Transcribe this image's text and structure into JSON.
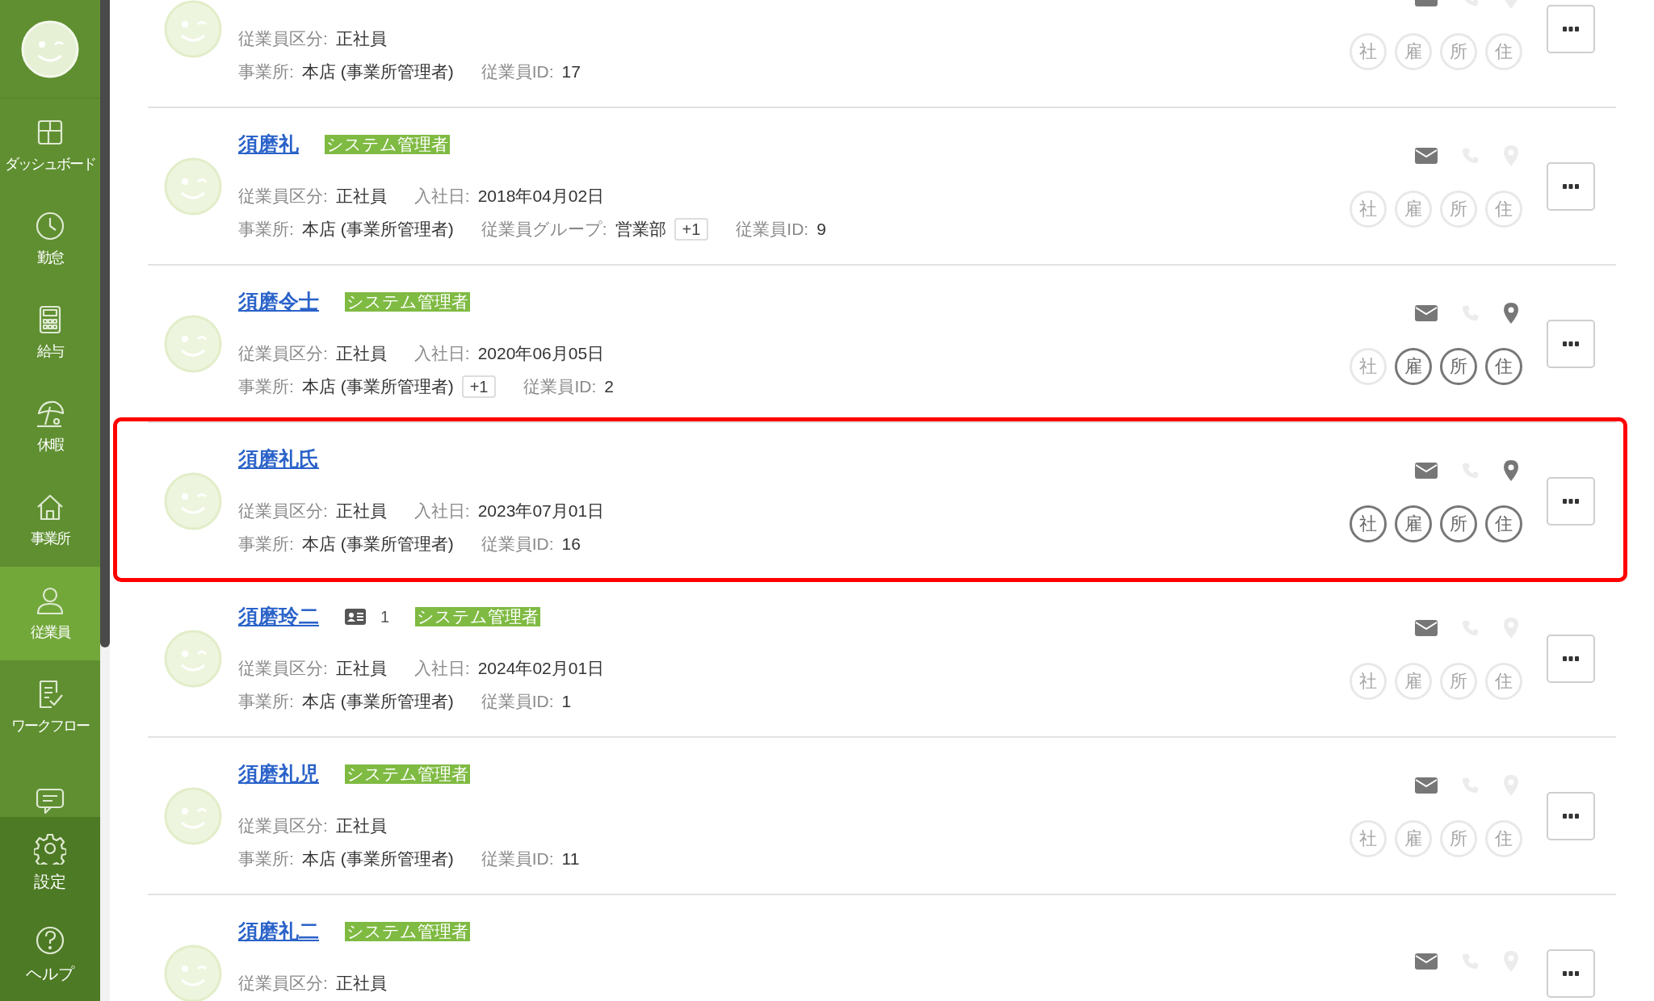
{
  "sidebar": {
    "items": [
      {
        "kind": "dashboard",
        "label": "ダッシュボード",
        "selected": false
      },
      {
        "kind": "clock",
        "label": "勤怠",
        "selected": false
      },
      {
        "kind": "calculator",
        "label": "給与",
        "selected": false
      },
      {
        "kind": "umbrella",
        "label": "休暇",
        "selected": false
      },
      {
        "kind": "house",
        "label": "事業所",
        "selected": false
      },
      {
        "kind": "person",
        "label": "従業員",
        "selected": true
      },
      {
        "kind": "checklist",
        "label": "ワークフロー",
        "selected": false
      },
      {
        "kind": "chat",
        "selected": false
      }
    ],
    "bottom_items": [
      {
        "kind": "gear",
        "label": "設定"
      },
      {
        "kind": "help",
        "label": "ヘルプ"
      }
    ]
  },
  "rows": [
    {
      "highlighted": false,
      "line1": [
        {
          "label": "従業員区分:",
          "value": "正社員"
        }
      ],
      "line2": [
        {
          "label": "事業所:",
          "value": "本店 (事業所管理者)"
        },
        {
          "label": "従業員ID:",
          "value": "17"
        }
      ],
      "contacts": [
        {
          "kind": "mail",
          "active": true
        },
        {
          "kind": "phone",
          "active": false
        },
        {
          "kind": "pin",
          "active": false
        }
      ],
      "stamps": [
        {
          "label": "社",
          "active": false
        },
        {
          "label": "雇",
          "active": false
        },
        {
          "label": "所",
          "active": false
        },
        {
          "label": "住",
          "active": false
        }
      ]
    },
    {
      "name": "須磨礼",
      "badge": "システム管理者",
      "highlighted": false,
      "line1": [
        {
          "label": "従業員区分:",
          "value": "正社員"
        },
        {
          "label": "入社日:",
          "value": "2018年04月02日"
        }
      ],
      "line2": [
        {
          "label": "事業所:",
          "value": "本店 (事業所管理者)"
        },
        {
          "label": "従業員グループ:",
          "value": "営業部",
          "extra": "+1"
        },
        {
          "label": "従業員ID:",
          "value": "9"
        }
      ],
      "contacts": [
        {
          "kind": "mail",
          "active": true
        },
        {
          "kind": "phone",
          "active": false
        },
        {
          "kind": "pin",
          "active": false
        }
      ],
      "stamps": [
        {
          "label": "社",
          "active": false
        },
        {
          "label": "雇",
          "active": false
        },
        {
          "label": "所",
          "active": false
        },
        {
          "label": "住",
          "active": false
        }
      ]
    },
    {
      "name": "須磨令士",
      "badge": "システム管理者",
      "highlighted": false,
      "line1": [
        {
          "label": "従業員区分:",
          "value": "正社員"
        },
        {
          "label": "入社日:",
          "value": "2020年06月05日"
        }
      ],
      "line2": [
        {
          "label": "事業所:",
          "value": "本店 (事業所管理者)",
          "extra": "+1"
        },
        {
          "label": "従業員ID:",
          "value": "2"
        }
      ],
      "contacts": [
        {
          "kind": "mail",
          "active": true
        },
        {
          "kind": "phone",
          "active": false
        },
        {
          "kind": "pin",
          "active": true
        }
      ],
      "stamps": [
        {
          "label": "社",
          "active": false
        },
        {
          "label": "雇",
          "active": true
        },
        {
          "label": "所",
          "active": true
        },
        {
          "label": "住",
          "active": true
        }
      ]
    },
    {
      "name": "須磨礼氏",
      "highlighted": true,
      "line1": [
        {
          "label": "従業員区分:",
          "value": "正社員"
        },
        {
          "label": "入社日:",
          "value": "2023年07月01日"
        }
      ],
      "line2": [
        {
          "label": "事業所:",
          "value": "本店 (事業所管理者)"
        },
        {
          "label": "従業員ID:",
          "value": "16"
        }
      ],
      "contacts": [
        {
          "kind": "mail",
          "active": true
        },
        {
          "kind": "phone",
          "active": false
        },
        {
          "kind": "pin",
          "active": true
        }
      ],
      "stamps": [
        {
          "label": "社",
          "active": true
        },
        {
          "label": "雇",
          "active": true
        },
        {
          "label": "所",
          "active": true
        },
        {
          "label": "住",
          "active": true
        }
      ]
    },
    {
      "name": "須磨玲二",
      "id_card_count": "1",
      "badge": "システム管理者",
      "highlighted": false,
      "line1": [
        {
          "label": "従業員区分:",
          "value": "正社員"
        },
        {
          "label": "入社日:",
          "value": "2024年02月01日"
        }
      ],
      "line2": [
        {
          "label": "事業所:",
          "value": "本店 (事業所管理者)"
        },
        {
          "label": "従業員ID:",
          "value": "1"
        }
      ],
      "contacts": [
        {
          "kind": "mail",
          "active": true
        },
        {
          "kind": "phone",
          "active": false
        },
        {
          "kind": "pin",
          "active": false
        }
      ],
      "stamps": [
        {
          "label": "社",
          "active": false
        },
        {
          "label": "雇",
          "active": false
        },
        {
          "label": "所",
          "active": false
        },
        {
          "label": "住",
          "active": false
        }
      ]
    },
    {
      "name": "須磨礼児",
      "badge": "システム管理者",
      "highlighted": false,
      "line1": [
        {
          "label": "従業員区分:",
          "value": "正社員"
        }
      ],
      "line2": [
        {
          "label": "事業所:",
          "value": "本店 (事業所管理者)"
        },
        {
          "label": "従業員ID:",
          "value": "11"
        }
      ],
      "contacts": [
        {
          "kind": "mail",
          "active": true
        },
        {
          "kind": "phone",
          "active": false
        },
        {
          "kind": "pin",
          "active": false
        }
      ],
      "stamps": [
        {
          "label": "社",
          "active": false
        },
        {
          "label": "雇",
          "active": false
        },
        {
          "label": "所",
          "active": false
        },
        {
          "label": "住",
          "active": false
        }
      ]
    },
    {
      "name": "須磨礼二",
      "badge": "システム管理者",
      "highlighted": false,
      "line1": [
        {
          "label": "従業員区分:",
          "value": "正社員"
        }
      ],
      "contacts": [
        {
          "kind": "mail",
          "active": true
        },
        {
          "kind": "phone",
          "active": false
        },
        {
          "kind": "pin",
          "active": false
        }
      ]
    }
  ]
}
